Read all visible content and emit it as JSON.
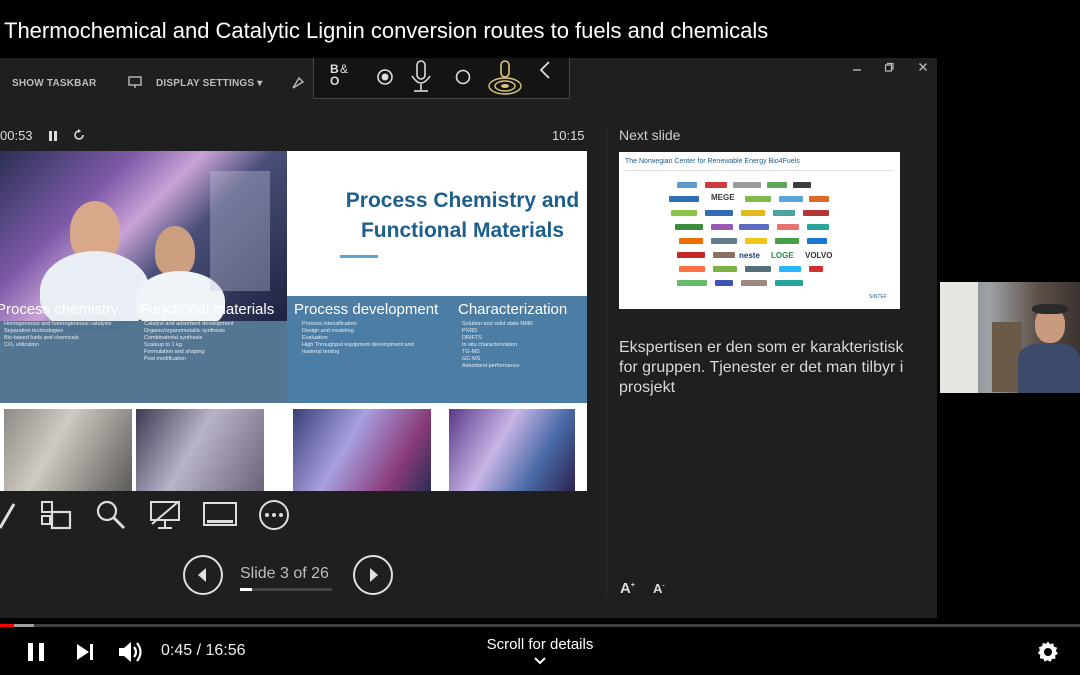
{
  "video": {
    "title": "Thermochemical and Catalytic Lignin conversion routes to fuels and chemicals"
  },
  "presenter": {
    "toolbar": {
      "show_taskbar": "SHOW TASKBAR",
      "display_settings": "DISPLAY SETTINGS ▾"
    },
    "timer_elapsed": "00:53",
    "clock": "10:15",
    "next_slide_label": "Next slide",
    "slide_counter": "Slide 3 of 26",
    "notes": "Ekspertisen er den som er karakteristisk for gruppen. Tjenester er det man tilbyr i prosjekt",
    "font_buttons": {
      "increase": "A",
      "decrease": "A"
    }
  },
  "current_slide": {
    "title_line1": "Process Chemistry and",
    "title_line2": "Functional Materials",
    "columns": [
      {
        "heading": "Process chemistry",
        "lines": [
          "Homogeneous and heterogeneous catalysis",
          "Separation technologies",
          "Bio-based fuels and chemicals",
          "CO₂ utilization"
        ]
      },
      {
        "heading": "Functional materials",
        "lines": [
          "Catalyst and adsorbent development",
          "Organic/organometallic synthesis",
          "Combinatorial synthesis",
          "Scaleup to 1 kg",
          "Formulation and shaping",
          "Post modification"
        ]
      },
      {
        "heading": "Process development",
        "lines": [
          "Process intensification",
          "Design and modeling",
          "Evaluation",
          "High Throughput equipment development and",
          "material testing"
        ]
      },
      {
        "heading": "Characterization",
        "lines": [
          "Solution and solid state NMR",
          "PXRD",
          "DRIFTS",
          "In situ characterization",
          "TG-MS",
          "GC-MS",
          "Adsorbent performance"
        ]
      }
    ]
  },
  "next_slide": {
    "title": "The Norwegian Center for Renewable Energy Bio4Fuels",
    "logos": [
      "SINTEF",
      "MEGE",
      "neste",
      "LOGE",
      "VOLVO"
    ]
  },
  "player": {
    "current_time": "0:45",
    "separator": " / ",
    "duration": "16:56",
    "scroll_hint": "Scroll for details",
    "progress_fraction": 0.045
  }
}
